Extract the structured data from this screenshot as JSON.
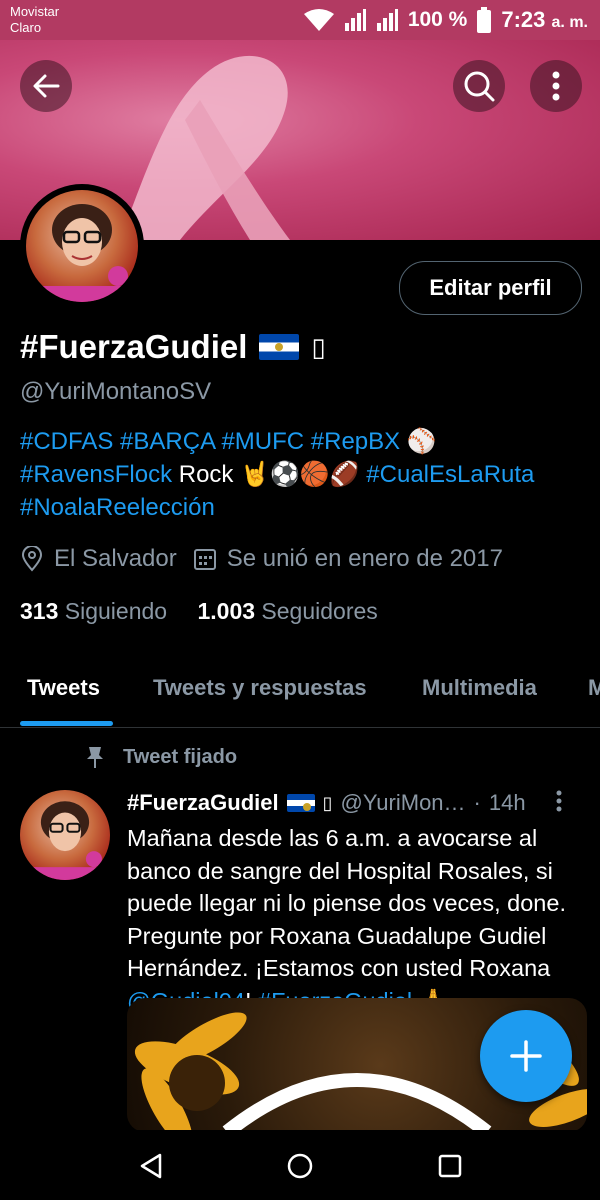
{
  "status": {
    "carrier_line1": "Movistar",
    "carrier_line2": "Claro",
    "battery": "100 %",
    "time": "7:23",
    "ampm": "a. m."
  },
  "header": {
    "back_icon": "arrow-left-icon",
    "search_icon": "search-icon",
    "more_icon": "more-vertical-icon"
  },
  "profile": {
    "edit_label": "Editar perfil",
    "name": "#FuerzaGudiel",
    "name_flag": "el-salvador-flag",
    "name_extra": "▯",
    "handle": "@YuriMontanoSV",
    "bio": {
      "line1": [
        "#CDFAS",
        "#BARÇA",
        "#MUFC",
        "#RepBX"
      ],
      "line1_emoji": "⚾",
      "line2_tag1": "#RavensFlock",
      "line2_text": "Rock 🤘⚽🏀🏈",
      "line2_tag2": "#CualEsLaRuta",
      "line3_tag": "#NoalaReelección"
    },
    "location": "El Salvador",
    "joined": "Se unió en enero de 2017",
    "following_count": "313",
    "following_label": "Siguiendo",
    "followers_count": "1.003",
    "followers_label": "Seguidores"
  },
  "tabs": [
    {
      "label": "Tweets",
      "active": true
    },
    {
      "label": "Tweets y respuestas",
      "active": false
    },
    {
      "label": "Multimedia",
      "active": false
    },
    {
      "label": "M",
      "active": false
    }
  ],
  "tweet": {
    "pinned_label": "Tweet fijado",
    "name": "#FuerzaGudiel",
    "extra": "▯",
    "handle": "@YuriMon…",
    "sep": "·",
    "time": "14h",
    "text_parts": {
      "p1": "Mañana desde las 6 a.m. a avocarse al banco de sangre del Hospital Rosales, si puede llegar ni lo piense dos veces, done. Pregunte por Roxana Guadalupe Gudiel Hernández. ¡Estamos con usted Roxana ",
      "mention": "@Gudiel04",
      "p2": "! ",
      "hashtag": "#FuerzaGudiel",
      "emoji": " 🙏"
    }
  },
  "colors": {
    "accent": "#1d9bf0",
    "secondary_text": "#8b98a5",
    "banner": "#c94877"
  }
}
